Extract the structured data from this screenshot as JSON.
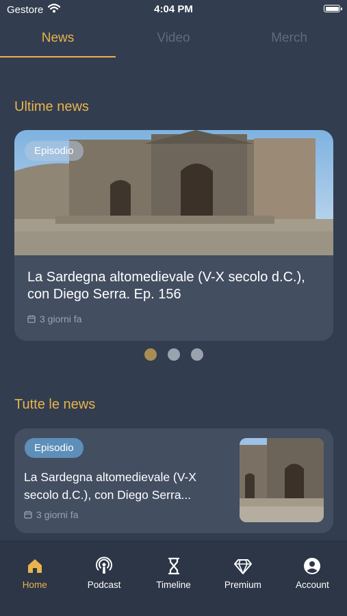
{
  "status_bar": {
    "carrier": "Gestore",
    "time": "4:04 PM"
  },
  "tabs": [
    {
      "label": "News",
      "active": true
    },
    {
      "label": "Video",
      "active": false
    },
    {
      "label": "Merch",
      "active": false
    }
  ],
  "sections": {
    "latest_title": "Ultime news",
    "all_title": "Tutte le news"
  },
  "featured": {
    "badge": "Episodio",
    "title": "La Sardegna altomedievale (V-X secolo d.C.), con Diego Serra. Ep. 156",
    "date": "3 giorni fa"
  },
  "carousel": {
    "count": 3,
    "active_index": 0
  },
  "news_list": [
    {
      "badge": "Episodio",
      "title": "La Sardegna altomedievale (V-X secolo d.C.), con Diego Serra...",
      "date": "3 giorni fa"
    }
  ],
  "bottom_nav": [
    {
      "label": "Home",
      "icon": "home-icon",
      "active": true
    },
    {
      "label": "Podcast",
      "icon": "podcast-icon",
      "active": false
    },
    {
      "label": "Timeline",
      "icon": "hourglass-icon",
      "active": false
    },
    {
      "label": "Premium",
      "icon": "diamond-icon",
      "active": false
    },
    {
      "label": "Account",
      "icon": "account-icon",
      "active": false
    }
  ],
  "colors": {
    "background": "#323d4f",
    "accent": "#e9b44c",
    "card": "#434e61",
    "badge": "#5d8fb8"
  }
}
